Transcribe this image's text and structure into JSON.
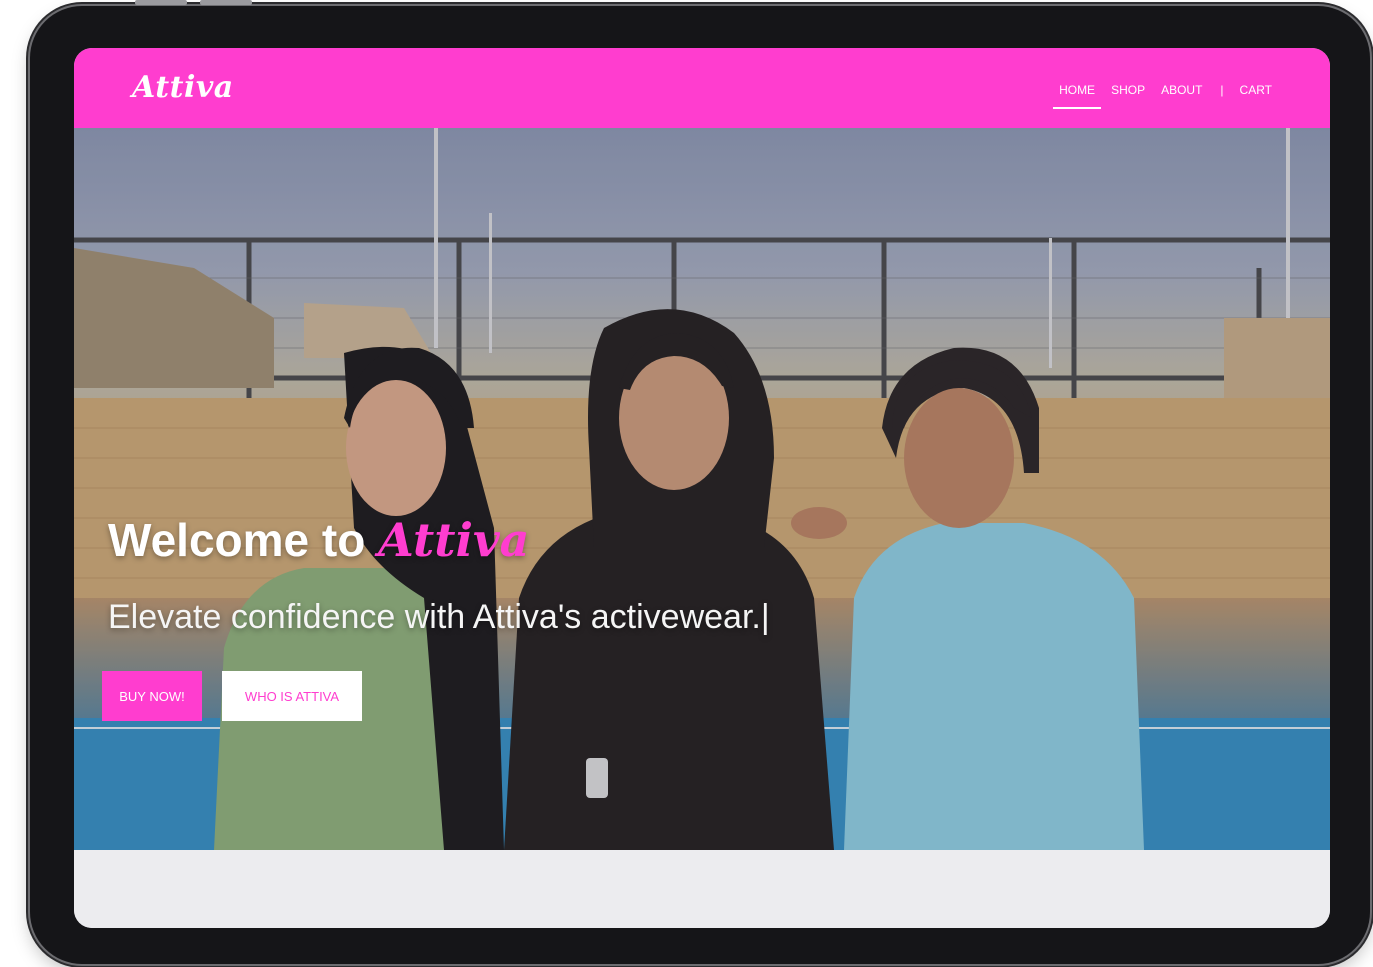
{
  "header": {
    "logo": "Attiva",
    "nav": [
      {
        "label": "HOME",
        "active": true
      },
      {
        "label": "SHOP",
        "active": false
      },
      {
        "label": "ABOUT",
        "active": false
      },
      {
        "label": "|",
        "separator": true
      },
      {
        "label": "CART",
        "active": false
      }
    ]
  },
  "hero": {
    "title_prefix": "Welcome to ",
    "title_brand": "Attiva",
    "subtitle": "Elevate confidence with Attiva's activewear.|",
    "buy_button": "BUY NOW!",
    "about_button": "WHO IS ATTIVA",
    "image_icon": "hero-photo"
  },
  "colors": {
    "brand_pink": "#ff3dcf",
    "frame": "#151518",
    "page_bg": "#ececef"
  }
}
